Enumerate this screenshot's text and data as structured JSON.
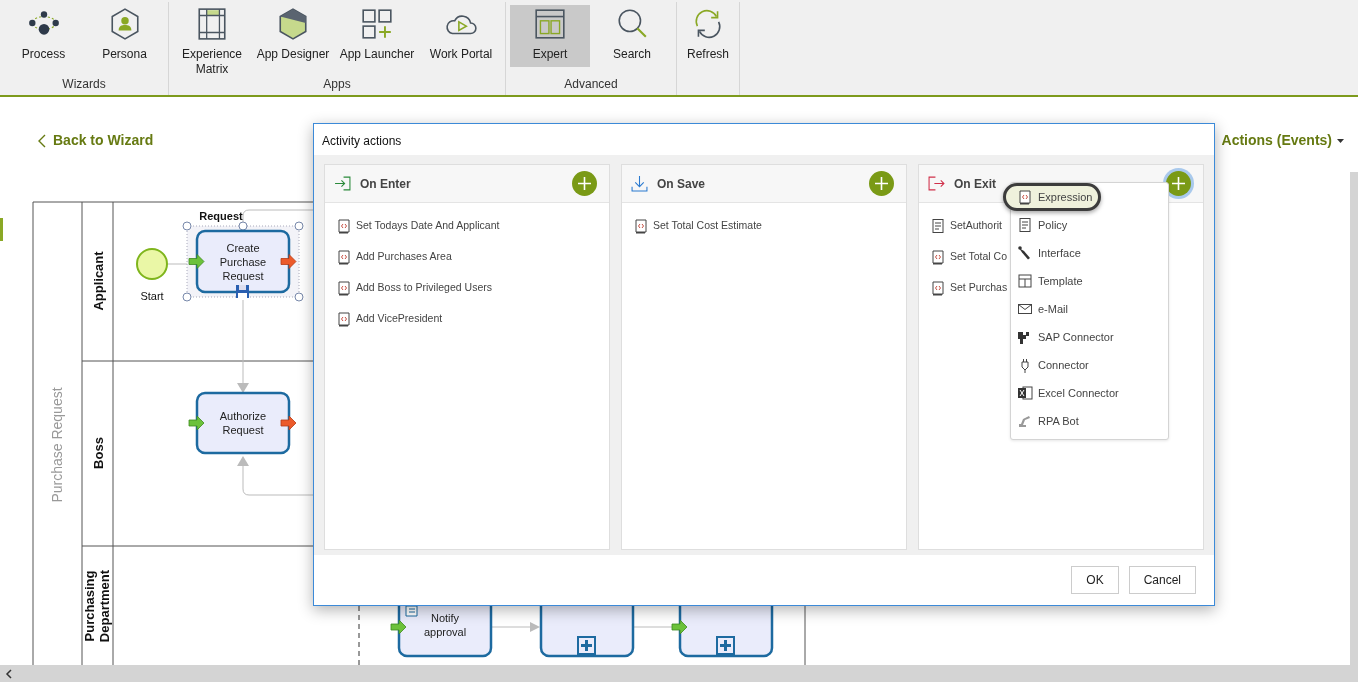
{
  "ribbon": {
    "groups": [
      {
        "label": "Wizards",
        "buttons": [
          {
            "label": "Process",
            "selected": false
          },
          {
            "label": "Persona",
            "selected": false
          }
        ]
      },
      {
        "label": "Apps",
        "buttons": [
          {
            "label": "Experience Matrix",
            "selected": false
          },
          {
            "label": "App Designer",
            "selected": false
          },
          {
            "label": "App Launcher",
            "selected": false
          },
          {
            "label": "Work Portal",
            "selected": false
          }
        ]
      },
      {
        "label": "Advanced",
        "buttons": [
          {
            "label": "Expert",
            "selected": true
          },
          {
            "label": "Search",
            "selected": false
          }
        ]
      },
      {
        "buttons": [
          {
            "label": "Refresh",
            "selected": false
          }
        ]
      }
    ]
  },
  "back_link": "Back to Wizard",
  "actions_menu": "Actions (Events)",
  "diagram": {
    "pool": "Purchase Request",
    "lanes": [
      "Applicant",
      "Boss",
      "Purchasing Department"
    ],
    "start_event": "Start",
    "annotation": "Request",
    "tasks": [
      {
        "label": "Create Purchase Request",
        "kind": "task",
        "selected": true
      },
      {
        "label": "Authorize Request",
        "kind": "task",
        "selected": false
      },
      {
        "label": "Notify approval",
        "kind": "task",
        "selected": false
      },
      {
        "kind": "subprocess",
        "selected": false
      },
      {
        "kind": "subprocess",
        "selected": false
      }
    ]
  },
  "dialog": {
    "title": "Activity actions",
    "columns": [
      {
        "title": "On Enter",
        "kind": "enter",
        "focused": false,
        "items": [
          {
            "label": "Set Todays Date And Applicant",
            "kind": "expression"
          },
          {
            "label": "Add Purchases Area",
            "kind": "expression"
          },
          {
            "label": "Add Boss to Privileged Users",
            "kind": "expression"
          },
          {
            "label": "Add VicePresident",
            "kind": "expression"
          }
        ]
      },
      {
        "title": "On Save",
        "kind": "save",
        "focused": false,
        "items": [
          {
            "label": "Set Total Cost Estimate",
            "kind": "expression"
          }
        ]
      },
      {
        "title": "On Exit",
        "kind": "exit",
        "focused": true,
        "items": [
          {
            "label": "SetAuthorit",
            "kind": "policy"
          },
          {
            "label": "Set Total Co",
            "kind": "expression"
          },
          {
            "label": "Set Purchas",
            "kind": "expression"
          }
        ]
      }
    ],
    "buttons": [
      "OK",
      "Cancel"
    ]
  },
  "add_menu": {
    "items": [
      {
        "label": "Expression",
        "selected": true
      },
      {
        "label": "Policy",
        "selected": false
      },
      {
        "label": "Interface",
        "selected": false
      },
      {
        "label": "Template",
        "selected": false
      },
      {
        "label": "e-Mail",
        "selected": false
      },
      {
        "label": "SAP Connector",
        "selected": false
      },
      {
        "label": "Connector",
        "selected": false
      },
      {
        "label": "Excel Connector",
        "selected": false
      },
      {
        "label": "RPA Bot",
        "selected": false
      }
    ]
  }
}
